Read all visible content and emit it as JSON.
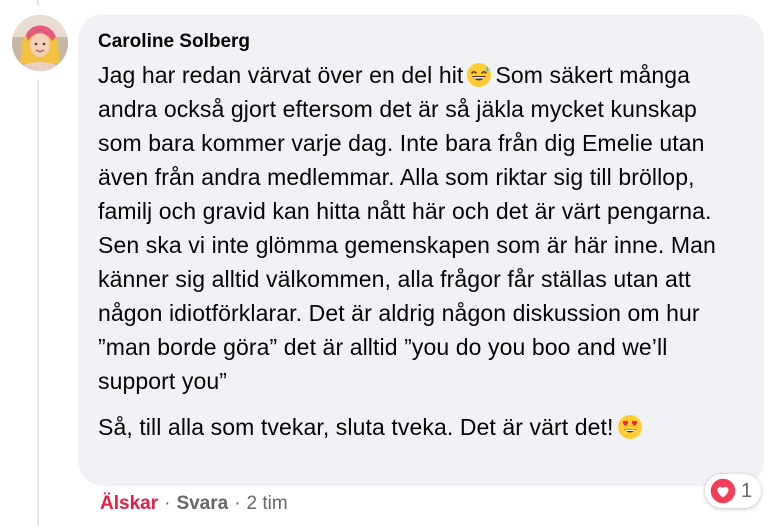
{
  "comment": {
    "author": "Caroline Solberg",
    "paragraph1_part1": "Jag har redan värvat över en del hit",
    "paragraph1_emoji": "grinning-face-with-sweat-icon",
    "paragraph1_part2": "Som säkert många andra också gjort eftersom det är så jäkla mycket kunskap som bara kommer varje dag. Inte bara från dig Emelie utan även från andra medlemmar. Alla som riktar sig till bröllop, familj och gravid kan hitta nått här och det är värt pengarna. Sen ska vi inte glömma gemenskapen som är här inne. Man känner sig alltid välkommen, alla frågor får ställas utan att någon idiotförklarar. Det är aldrig någon diskussion om hur ”man borde göra” det är alltid ”you do you boo and we’ll support you”",
    "paragraph2_text": "Så, till alla som tvekar, sluta tveka. Det är värt det!",
    "paragraph2_emoji": "smiling-face-with-heart-eyes-icon"
  },
  "reactions": {
    "icon": "love-reaction-icon",
    "count": "1",
    "color": "#f33e58"
  },
  "actions": {
    "love_label": "Älskar",
    "separator": "·",
    "reply_label": "Svara",
    "time_label": "2 tim"
  },
  "colors": {
    "bubble": "#f0f2f5",
    "text": "#050505",
    "secondary": "#65676b",
    "love": "#e41e3f"
  }
}
